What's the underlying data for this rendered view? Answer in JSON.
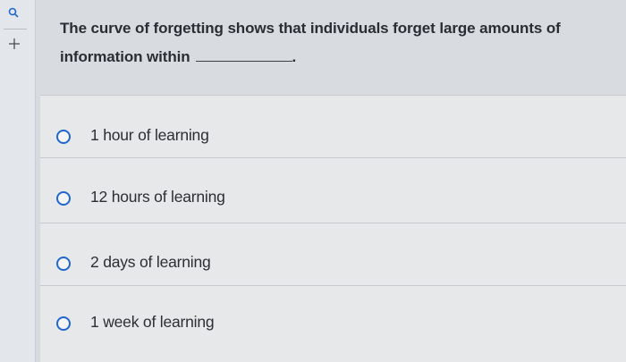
{
  "sidebar": {
    "search_icon": "search-icon",
    "add_icon": "plus-icon"
  },
  "question": {
    "text_line1": "The curve of forgetting shows that individuals forget large amounts of",
    "text_line2": "information within",
    "blank_suffix": "."
  },
  "options": [
    {
      "label": "1 hour of learning"
    },
    {
      "label": "12 hours of learning"
    },
    {
      "label": "2 days of learning"
    },
    {
      "label": "1 week of learning"
    }
  ],
  "colors": {
    "radio_border": "#2266cc",
    "text": "#2b2e33"
  }
}
